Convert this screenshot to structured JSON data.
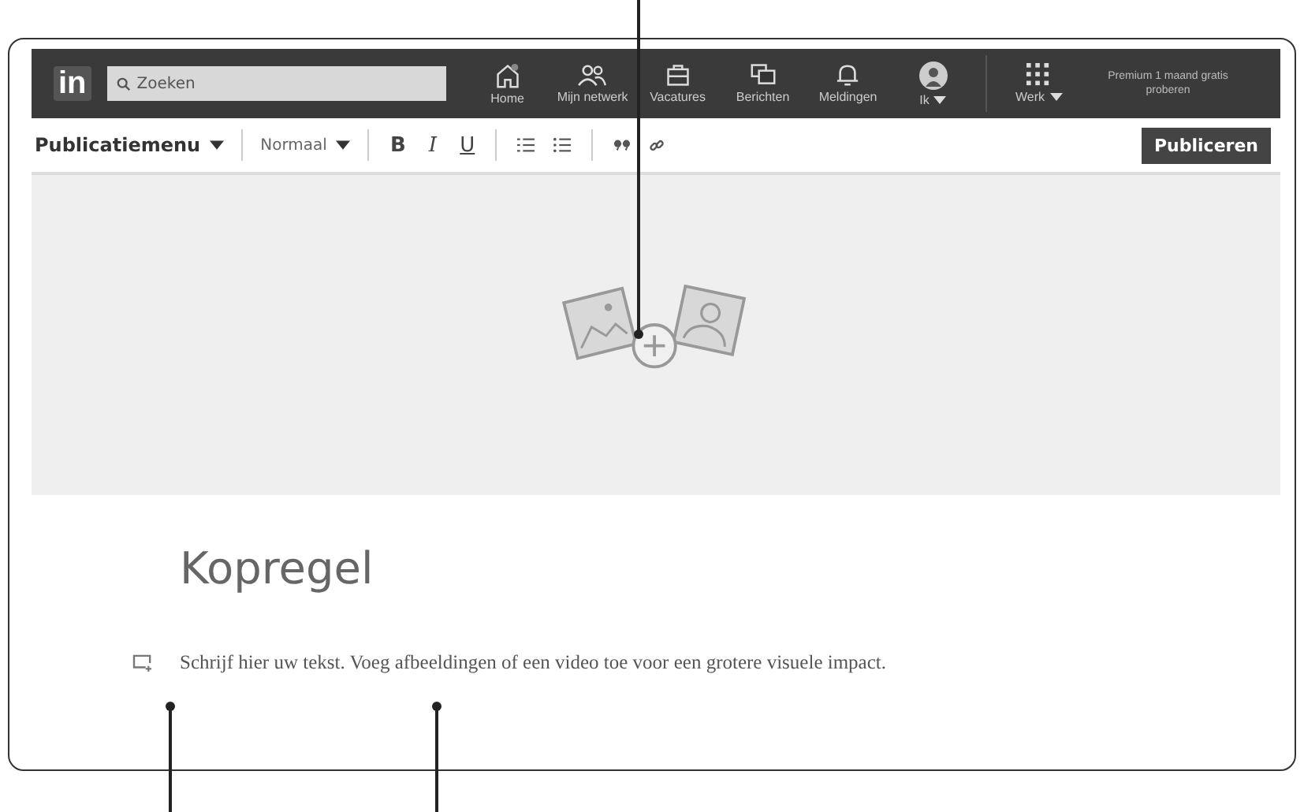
{
  "navbar": {
    "logo": "in",
    "search": {
      "placeholder": "Zoeken"
    },
    "items": [
      {
        "kind": "home",
        "label": "Home",
        "dropdown": false
      },
      {
        "kind": "network",
        "label": "Mijn netwerk",
        "dropdown": false
      },
      {
        "kind": "jobs",
        "label": "Vacatures",
        "dropdown": false
      },
      {
        "kind": "messages",
        "label": "Berichten",
        "dropdown": false
      },
      {
        "kind": "notifications",
        "label": "Meldingen",
        "dropdown": false
      },
      {
        "kind": "me",
        "label": "Ik",
        "dropdown": true
      },
      {
        "kind": "apps",
        "label": "Werk",
        "dropdown": true
      }
    ],
    "premium": "Premium 1 maand gratis proberen"
  },
  "toolbar": {
    "menu": "Publicatiemenu",
    "style": "Normaal",
    "format_buttons": [
      "B",
      "I",
      "U"
    ],
    "publish": "Publiceren"
  },
  "editor": {
    "headline_placeholder": "Kopregel",
    "body_placeholder": "Schrijf hier uw tekst. Voeg afbeeldingen of een video toe voor een grotere visuele impact."
  }
}
